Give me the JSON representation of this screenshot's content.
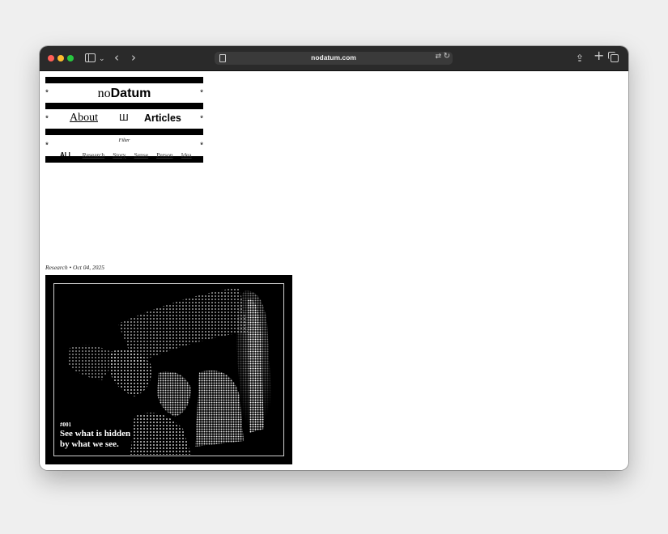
{
  "browser": {
    "url": "nodatum.com"
  },
  "site": {
    "logo_prefix": "no",
    "logo_name": "Datum",
    "asterisk": "*",
    "nav": {
      "about": "About",
      "glyph": "Ш",
      "articles": "Articles"
    },
    "filter": {
      "label": "Filter",
      "items": [
        "ALL",
        "Research",
        "Story",
        "Sense",
        "Person",
        "Idea"
      ]
    }
  },
  "article": {
    "category": "Research",
    "separator": "•",
    "date": "Oct 04, 2025",
    "issue": "#001",
    "tagline_line1": "See what is hidden",
    "tagline_line2": "by what we see."
  },
  "colors": {
    "page_bg": "#efefef",
    "toolbar": "#2a2a2a",
    "ink": "#000000"
  }
}
